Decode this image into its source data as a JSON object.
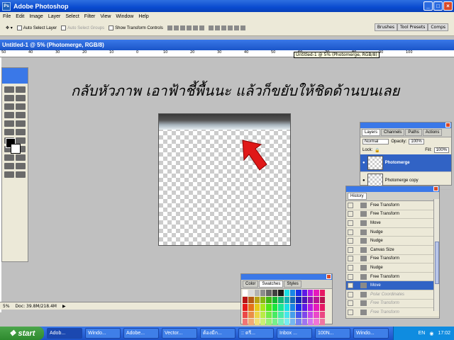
{
  "app": {
    "title": "Adobe Photoshop"
  },
  "menu": [
    "File",
    "Edit",
    "Image",
    "Layer",
    "Select",
    "Filter",
    "View",
    "Window",
    "Help"
  ],
  "options": {
    "auto_select_layer": "Auto Select Layer",
    "auto_select_groups": "Auto Select Groups",
    "show_transform": "Show Transform Controls"
  },
  "wells": [
    "Brushes",
    "Tool Presets",
    "Comps"
  ],
  "document": {
    "title": "Untitled-1 @ 5% (Photomerge, RGB/8)",
    "tooltip": "Untitled-1 @ 5% (Photomerge, RGB/8)",
    "zoom": "5%",
    "doc_size": "Doc: 39.8M/218.4M"
  },
  "ruler_ticks": [
    "50",
    "40",
    "30",
    "20",
    "10",
    "0",
    "10",
    "20",
    "30",
    "40",
    "50",
    "60",
    "70",
    "80",
    "90",
    "100"
  ],
  "annotation": {
    "text": "กลับหัวภาพ เอาฟ้าชี้พื้นนะ แล้วก็ขยับให้ชิดด้านบนเลย"
  },
  "layers_panel": {
    "tabs": [
      "Layers",
      "Channels",
      "Paths",
      "Actions"
    ],
    "blend_mode": "Normal",
    "opacity_label": "Opacity:",
    "opacity": "100%",
    "lock_label": "Lock:",
    "fill_label": "Fill:",
    "fill": "100%",
    "layers": [
      "Photomerge",
      "Photomerge copy"
    ]
  },
  "history_panel": {
    "tab": "History",
    "items": [
      "Free Transform",
      "Free Transform",
      "Move",
      "Nudge",
      "Nudge",
      "Canvas Size",
      "Free Transform",
      "Nudge",
      "Free Transform",
      "Move",
      "Polar Coordinates",
      "Free Transform",
      "Free Transform"
    ]
  },
  "swatches_panel": {
    "tabs": [
      "Color",
      "Swatches",
      "Styles"
    ]
  },
  "taskbar": {
    "start": "start",
    "tasks": [
      "Adob...",
      "Windo...",
      "Adobe...",
      "Vector...",
      "ต้องมีก...",
      ":: ตรี...",
      "Inbox ...",
      "100N...",
      "Windo..."
    ],
    "lang": "EN",
    "time": "17:02"
  }
}
